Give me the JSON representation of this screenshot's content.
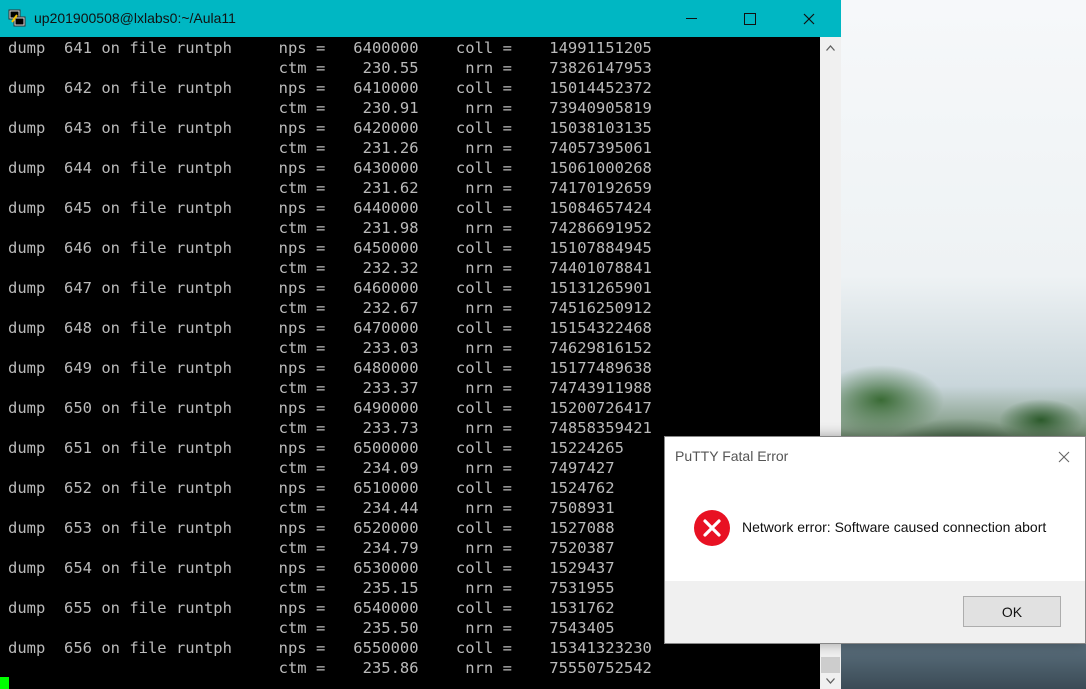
{
  "window": {
    "title": "up201900508@lxlabs0:~/Aula11"
  },
  "terminal": {
    "lines": [
      "dump  641 on file runtph     nps =   6400000    coll =    14991151205",
      "                             ctm =    230.55     nrn =    73826147953",
      "dump  642 on file runtph     nps =   6410000    coll =    15014452372",
      "                             ctm =    230.91     nrn =    73940905819",
      "dump  643 on file runtph     nps =   6420000    coll =    15038103135",
      "                             ctm =    231.26     nrn =    74057395061",
      "dump  644 on file runtph     nps =   6430000    coll =    15061000268",
      "                             ctm =    231.62     nrn =    74170192659",
      "dump  645 on file runtph     nps =   6440000    coll =    15084657424",
      "                             ctm =    231.98     nrn =    74286691952",
      "dump  646 on file runtph     nps =   6450000    coll =    15107884945",
      "                             ctm =    232.32     nrn =    74401078841",
      "dump  647 on file runtph     nps =   6460000    coll =    15131265901",
      "                             ctm =    232.67     nrn =    74516250912",
      "dump  648 on file runtph     nps =   6470000    coll =    15154322468",
      "                             ctm =    233.03     nrn =    74629816152",
      "dump  649 on file runtph     nps =   6480000    coll =    15177489638",
      "                             ctm =    233.37     nrn =    74743911988",
      "dump  650 on file runtph     nps =   6490000    coll =    15200726417",
      "                             ctm =    233.73     nrn =    74858359421",
      "dump  651 on file runtph     nps =   6500000    coll =    15224265",
      "                             ctm =    234.09     nrn =    7497427",
      "dump  652 on file runtph     nps =   6510000    coll =    1524762",
      "                             ctm =    234.44     nrn =    7508931",
      "dump  653 on file runtph     nps =   6520000    coll =    1527088",
      "                             ctm =    234.79     nrn =    7520387",
      "dump  654 on file runtph     nps =   6530000    coll =    1529437",
      "                             ctm =    235.15     nrn =    7531955",
      "dump  655 on file runtph     nps =   6540000    coll =    1531762",
      "                             ctm =    235.50     nrn =    7543405",
      "dump  656 on file runtph     nps =   6550000    coll =    15341323230",
      "                             ctm =    235.86     nrn =    75550752542"
    ]
  },
  "dialog": {
    "title": "PuTTY Fatal Error",
    "message": "Network error: Software caused connection abort",
    "ok_label": "OK"
  },
  "colors": {
    "titlebar": "#00b7c3",
    "terminal_bg": "#000000",
    "terminal_fg": "#bbbbbb",
    "cursor": "#00ff00",
    "error_red": "#e81123"
  }
}
